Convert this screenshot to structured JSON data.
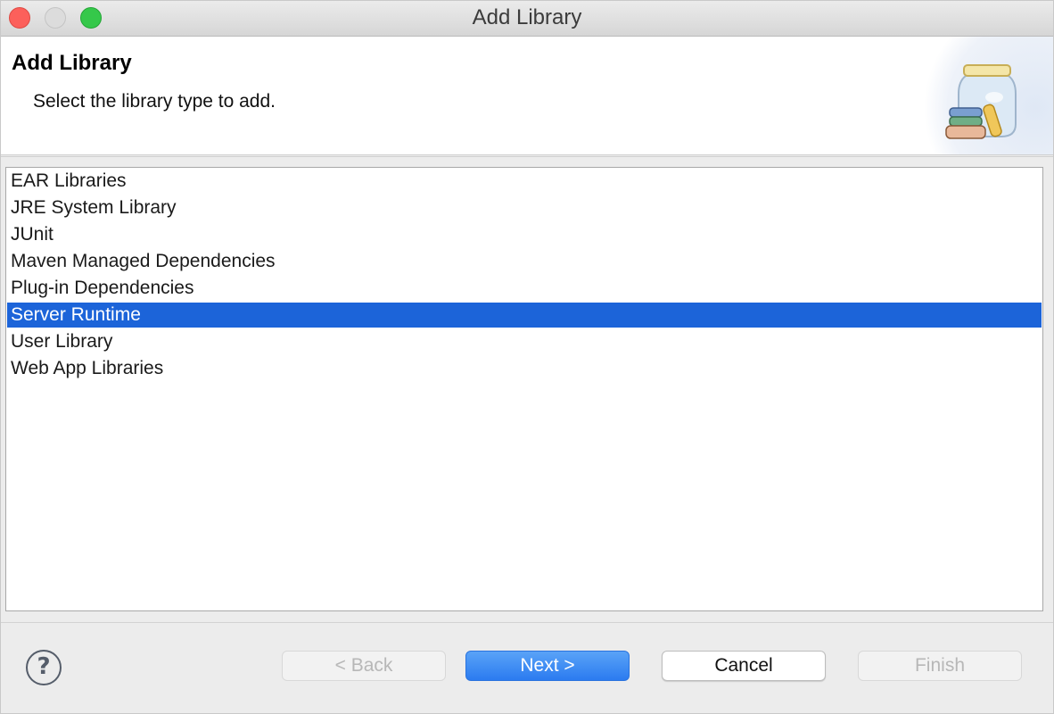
{
  "window": {
    "title": "Add Library"
  },
  "banner": {
    "title": "Add Library",
    "description": "Select the library type to add.",
    "icon": "library-jar-icon"
  },
  "list": {
    "items": [
      {
        "label": "EAR Libraries",
        "selected": false
      },
      {
        "label": "JRE System Library",
        "selected": false
      },
      {
        "label": "JUnit",
        "selected": false
      },
      {
        "label": "Maven Managed Dependencies",
        "selected": false
      },
      {
        "label": "Plug-in Dependencies",
        "selected": false
      },
      {
        "label": "Server Runtime",
        "selected": true
      },
      {
        "label": "User Library",
        "selected": false
      },
      {
        "label": "Web App Libraries",
        "selected": false
      }
    ]
  },
  "footer": {
    "help_glyph": "?",
    "back_label": "< Back",
    "next_label": "Next >",
    "cancel_label": "Cancel",
    "finish_label": "Finish"
  },
  "colors": {
    "selection": "#1c64d9",
    "primary_button": "#2b7bf0"
  }
}
